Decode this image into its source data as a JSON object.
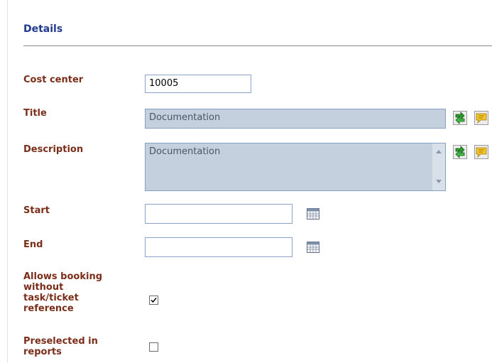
{
  "section": {
    "title": "Details"
  },
  "fields": {
    "cost_center": {
      "label": "Cost center",
      "value": "10005"
    },
    "title": {
      "label": "Title",
      "value": "Documentation"
    },
    "description": {
      "label": "Description",
      "value": "Documentation"
    },
    "start": {
      "label": "Start",
      "value": ""
    },
    "end": {
      "label": "End",
      "value": ""
    },
    "allows_booking": {
      "label_lines": [
        "Allows booking",
        "without",
        "task/ticket",
        "reference"
      ],
      "checked": true
    },
    "preselected": {
      "label_lines": [
        "Preselected in",
        "reports"
      ],
      "checked": false
    }
  },
  "icons": {
    "translate": "green-arrows-icon",
    "comment": "yellow-note-icon",
    "calendar": "calendar-icon"
  }
}
